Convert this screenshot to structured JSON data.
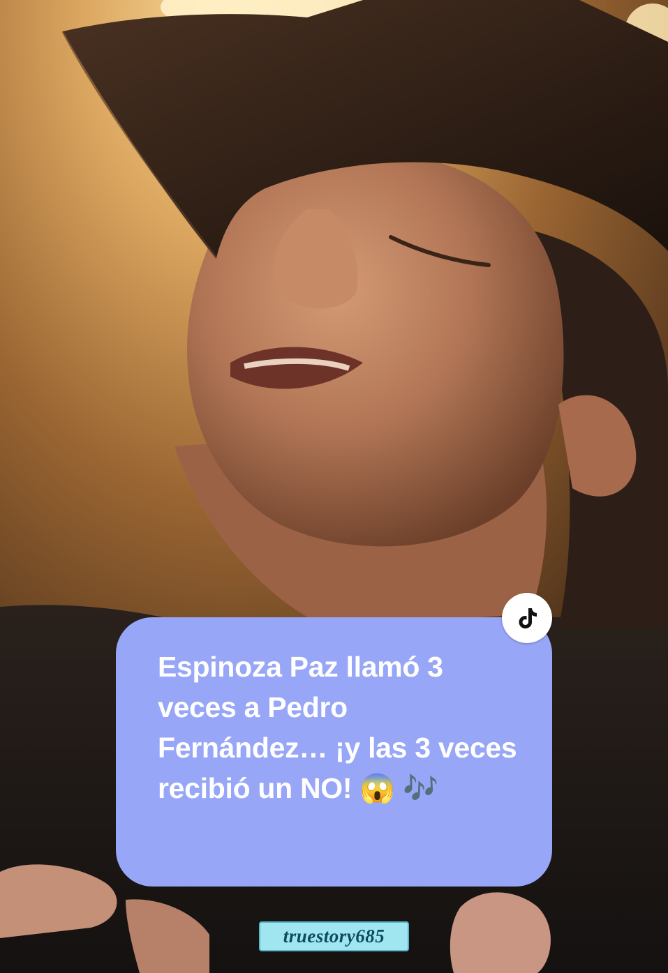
{
  "caption": {
    "text": "Espinoza Paz llamó 3 veces a Pedro Fernández… ¡y las 3 veces recibió un NO! 😱 🎶"
  },
  "badge": {
    "icon": "tiktok-icon"
  },
  "handle": {
    "text": "truestory685"
  },
  "colors": {
    "caption_bg": "#97a6f6",
    "caption_text": "#ffffff",
    "handle_bg": "#9fe6f0",
    "handle_text": "#0f4a5f"
  }
}
